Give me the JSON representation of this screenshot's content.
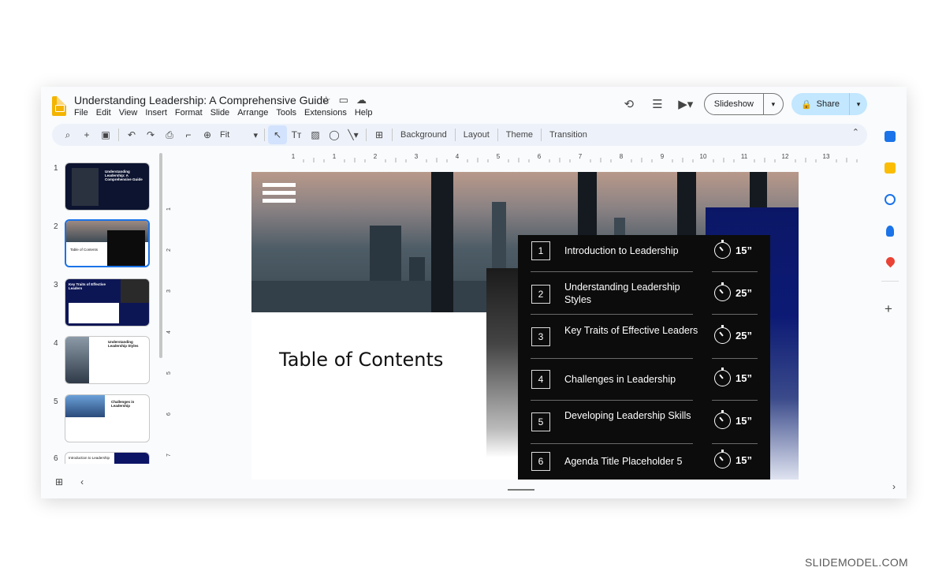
{
  "header": {
    "title": "Understanding Leadership: A Comprehensive Guide",
    "menu": [
      "File",
      "Edit",
      "View",
      "Insert",
      "Format",
      "Slide",
      "Arrange",
      "Tools",
      "Extensions",
      "Help"
    ],
    "slideshow_label": "Slideshow",
    "share_label": "Share"
  },
  "toolbar": {
    "zoom_value": "Fit",
    "background_label": "Background",
    "layout_label": "Layout",
    "theme_label": "Theme",
    "transition_label": "Transition"
  },
  "ruler": {
    "top_marks": [
      "1",
      "1",
      "2",
      "3",
      "4",
      "5",
      "6",
      "7",
      "8",
      "9",
      "10",
      "11",
      "12",
      "13"
    ],
    "left_marks": [
      "1",
      "2",
      "3",
      "4",
      "5",
      "6",
      "7"
    ]
  },
  "filmstrip": {
    "slides": [
      {
        "number": "1",
        "title": "Understanding Leadership: A Comprehensive Guide"
      },
      {
        "number": "2",
        "title": "Table of Contents"
      },
      {
        "number": "3",
        "title": "Key Traits of Effective Leaders"
      },
      {
        "number": "4",
        "title": "Understanding Leadership Styles"
      },
      {
        "number": "5",
        "title": "Challenges in Leadership"
      },
      {
        "number": "6",
        "title": "Introduction to Leadership"
      }
    ]
  },
  "slide": {
    "title": "Table of Contents",
    "agenda": [
      {
        "num": "1",
        "text": "Introduction to Leadership",
        "time": "15”"
      },
      {
        "num": "2",
        "text": "Understanding Leadership Styles",
        "time": "25”"
      },
      {
        "num": "3",
        "text": "Key Traits of Effective Leaders",
        "time": "25”"
      },
      {
        "num": "4",
        "text": "Challenges in Leadership",
        "time": "15”"
      },
      {
        "num": "5",
        "text": "Developing Leadership Skills",
        "time": "15”"
      },
      {
        "num": "6",
        "text": "Agenda Title Placeholder 5",
        "time": "15”"
      }
    ]
  },
  "watermark": "SLIDEMODEL.COM",
  "colors": {
    "accent": "#1a73e8",
    "share_bg": "#c2e7ff",
    "navy": "#0d1a75",
    "agenda_bg": "#0c0c0c"
  }
}
